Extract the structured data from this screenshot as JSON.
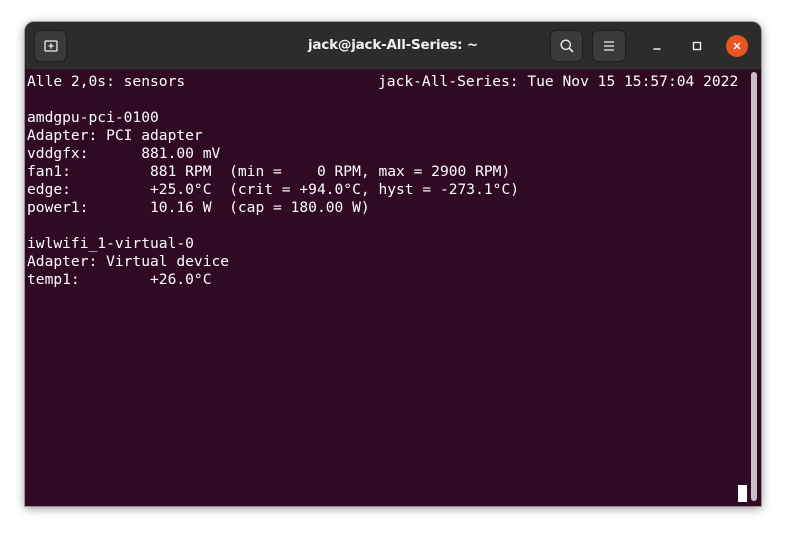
{
  "window": {
    "title": "jack@jack-All-Series: ~"
  },
  "titlebar": {
    "icons": [
      "new-tab-icon",
      "search-icon",
      "hamburger-menu-icon",
      "minimize-icon",
      "maximize-icon",
      "close-icon"
    ],
    "close_color": "#e95420"
  },
  "terminal": {
    "background": "#300a24",
    "header_left": "Alle 2,0s: sensors",
    "header_right": "jack-All-Series: Tue Nov 15 15:57:04 2022",
    "lines": [
      "",
      "amdgpu-pci-0100",
      "Adapter: PCI adapter",
      "vddgfx:      881.00 mV",
      "fan1:         881 RPM  (min =    0 RPM, max = 2900 RPM)",
      "edge:         +25.0°C  (crit = +94.0°C, hyst = -273.1°C)",
      "power1:       10.16 W  (cap = 180.00 W)",
      "",
      "iwlwifi_1-virtual-0",
      "Adapter: Virtual device",
      "temp1:        +26.0°C"
    ]
  }
}
